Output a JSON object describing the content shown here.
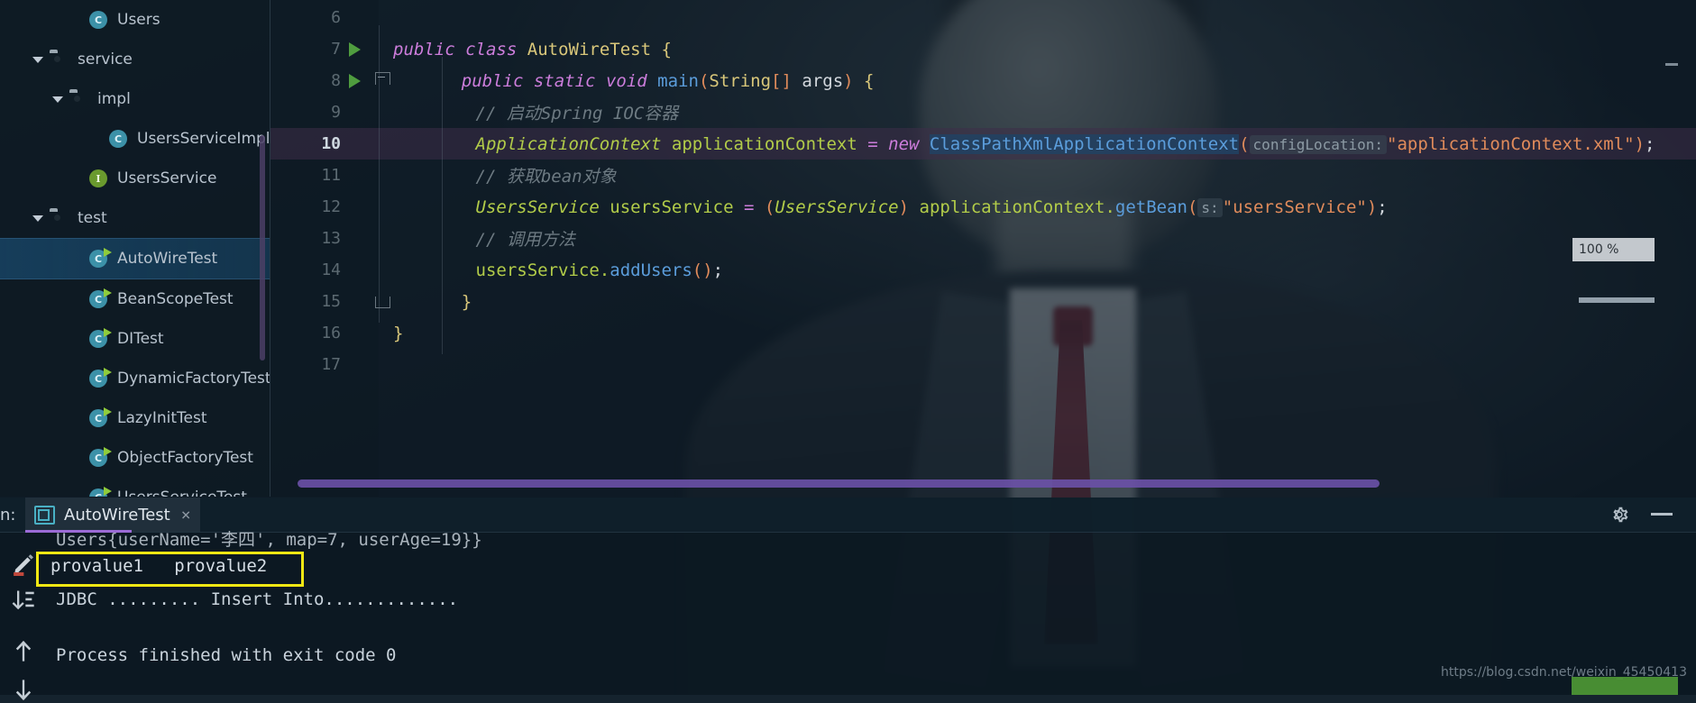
{
  "sidebar": {
    "name": "project-tree",
    "items": [
      {
        "label": "Users",
        "icon": "class-icon",
        "glyph": "C",
        "indent": 3,
        "arrow": false,
        "selected": false,
        "clipped": false
      },
      {
        "label": "service",
        "icon": "folder-icon",
        "glyph": "",
        "indent": 1,
        "arrow": true,
        "selected": false,
        "clipped": false
      },
      {
        "label": "impl",
        "icon": "folder-icon",
        "glyph": "",
        "indent": 2,
        "arrow": true,
        "selected": false,
        "clipped": false
      },
      {
        "label": "UsersServiceImpl",
        "icon": "class-icon",
        "glyph": "C",
        "indent": 4,
        "arrow": false,
        "selected": false,
        "clipped": true
      },
      {
        "label": "UsersService",
        "icon": "interface-icon",
        "glyph": "I",
        "indent": 3,
        "arrow": false,
        "selected": false,
        "clipped": false
      },
      {
        "label": "test",
        "icon": "folder-icon",
        "glyph": "",
        "indent": 1,
        "arrow": true,
        "selected": false,
        "clipped": false
      },
      {
        "label": "AutoWireTest",
        "icon": "runnable-class-icon",
        "glyph": "C",
        "indent": 3,
        "arrow": false,
        "selected": true,
        "clipped": false
      },
      {
        "label": "BeanScopeTest",
        "icon": "runnable-class-icon",
        "glyph": "C",
        "indent": 3,
        "arrow": false,
        "selected": false,
        "clipped": false
      },
      {
        "label": "DITest",
        "icon": "runnable-class-icon",
        "glyph": "C",
        "indent": 3,
        "arrow": false,
        "selected": false,
        "clipped": false
      },
      {
        "label": "DynamicFactoryTest",
        "icon": "runnable-class-icon",
        "glyph": "C",
        "indent": 3,
        "arrow": false,
        "selected": false,
        "clipped": true
      },
      {
        "label": "LazyInitTest",
        "icon": "runnable-class-icon",
        "glyph": "C",
        "indent": 3,
        "arrow": false,
        "selected": false,
        "clipped": false
      },
      {
        "label": "ObjectFactoryTest",
        "icon": "runnable-class-icon",
        "glyph": "C",
        "indent": 3,
        "arrow": false,
        "selected": false,
        "clipped": true
      },
      {
        "label": "UsersServiceTest",
        "icon": "runnable-class-icon",
        "glyph": "C",
        "indent": 3,
        "arrow": false,
        "selected": false,
        "clipped": false
      }
    ]
  },
  "editor": {
    "zoom_badge": "100 %",
    "lines": [
      {
        "number": "6",
        "current": false,
        "gutter": "none"
      },
      {
        "number": "7",
        "current": false,
        "gutter": "run"
      },
      {
        "number": "8",
        "current": false,
        "gutter": "run-fold"
      },
      {
        "number": "9",
        "current": false,
        "gutter": "none"
      },
      {
        "number": "10",
        "current": true,
        "gutter": "none"
      },
      {
        "number": "11",
        "current": false,
        "gutter": "none"
      },
      {
        "number": "12",
        "current": false,
        "gutter": "none"
      },
      {
        "number": "13",
        "current": false,
        "gutter": "none"
      },
      {
        "number": "14",
        "current": false,
        "gutter": "none"
      },
      {
        "number": "15",
        "current": false,
        "gutter": "endfold"
      },
      {
        "number": "16",
        "current": false,
        "gutter": "none"
      },
      {
        "number": "17",
        "current": false,
        "gutter": "none"
      }
    ],
    "code": {
      "l7_public": "public",
      "l7_class": "class",
      "l7_name": "AutoWireTest",
      "l7_brace": "{",
      "l8_public": "public",
      "l8_static": "static",
      "l8_void": "void",
      "l8_main": "main",
      "l8_lparen": "(",
      "l8_string": "String",
      "l8_brackets": "[]",
      "l8_args": "args",
      "l8_rparen": ")",
      "l8_brace": "{",
      "l9_comment": "// 启动Spring IOC容器",
      "l10_type": "ApplicationContext",
      "l10_var": "applicationContext",
      "l10_eq": "=",
      "l10_new": "new",
      "l10_ctor": "ClassPathXmlApplicationContext",
      "l10_lparen": "(",
      "l10_hint": "configLocation:",
      "l10_str": "\"applicationContext.xml\"",
      "l10_rparen": ")",
      "l10_semi": ";",
      "l11_comment": "// 获取bean对象",
      "l12_type": "UsersService",
      "l12_var": "usersService",
      "l12_eq": "=",
      "l12_cast_l": "(",
      "l12_cast": "UsersService",
      "l12_cast_r": ")",
      "l12_obj": "applicationContext",
      "l12_dot": ".",
      "l12_method": "getBean",
      "l12_lparen": "(",
      "l12_hint": "s:",
      "l12_str": "\"usersService\"",
      "l12_rparen": ")",
      "l12_semi": ";",
      "l13_comment": "// 调用方法",
      "l14_obj": "usersService",
      "l14_dot": ".",
      "l14_method": "addUsers",
      "l14_parens": "()",
      "l14_semi": ";",
      "l15_brace": "}",
      "l16_brace": "}"
    }
  },
  "console": {
    "run_label": "n:",
    "tab_label": "AutoWireTest",
    "tab_close": "×",
    "clipped_line": "Users{userName='李四', map=7, userAge=19}}",
    "highlighted_output": "provalue1   provalue2",
    "jdbc_line": "JDBC ......... Insert Into.............",
    "exit_line": "Process finished with exit code 0",
    "watermark": "https://blog.csdn.net/weixin_45450413",
    "highlight_color": "#f2e713"
  }
}
